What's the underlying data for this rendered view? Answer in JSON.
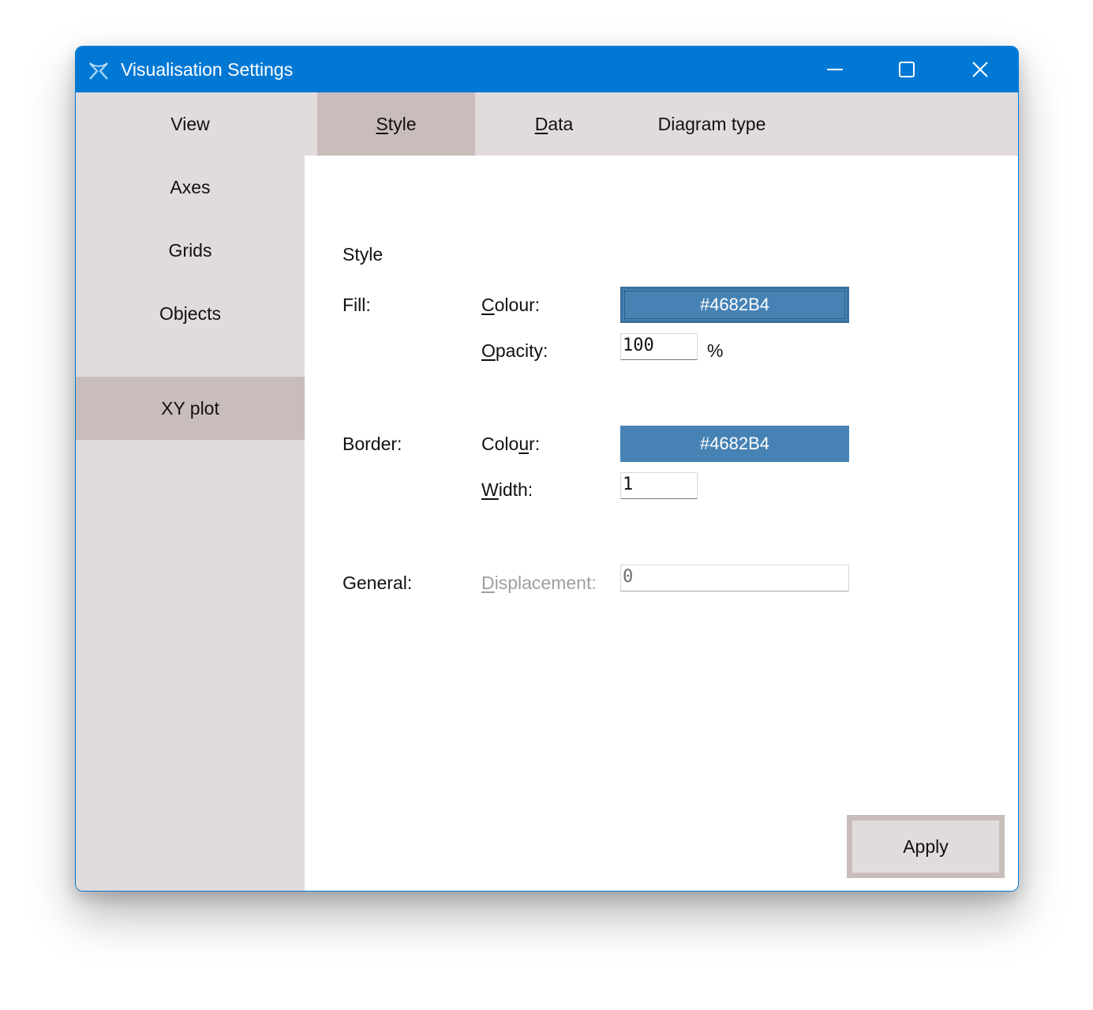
{
  "window": {
    "title": "Visualisation Settings",
    "accent_color": "#0078d4"
  },
  "title_buttons": {
    "minimize_icon": "minimize-icon",
    "maximize_icon": "maximize-icon",
    "close_icon": "close-icon"
  },
  "sidebar": {
    "items": [
      {
        "label": "View"
      },
      {
        "label": "Axes"
      },
      {
        "label": "Grids"
      },
      {
        "label": "Objects"
      },
      {
        "label": "XY plot",
        "active": true
      }
    ]
  },
  "tabs": [
    {
      "accel": "S",
      "rest": "tyle",
      "active": true
    },
    {
      "accel": "D",
      "rest": "ata"
    },
    {
      "pre": "Dia",
      "accel": "g",
      "rest": "ram type"
    }
  ],
  "style": {
    "section_title": "Style",
    "fill": {
      "label": "Fill:",
      "colour_label_accel": "C",
      "colour_label_rest": "olour:",
      "colour_value": "#4682B4",
      "opacity_label_accel": "O",
      "opacity_label_rest": "pacity:",
      "opacity_value": "100",
      "opacity_unit": "%"
    },
    "border": {
      "label": "Border:",
      "colour_label_pre": "Colo",
      "colour_label_accel": "u",
      "colour_label_rest": "r:",
      "colour_value": "#4682B4",
      "width_label_accel": "W",
      "width_label_rest": "idth:",
      "width_value": "1"
    },
    "general": {
      "label": "General:",
      "displacement_label_accel": "D",
      "displacement_label_rest": "isplacement:",
      "displacement_value": "0"
    }
  },
  "footer": {
    "apply_label": "Apply"
  },
  "colors": {
    "swatch": "#4682b4",
    "panel_bg": "#e1dcdb",
    "selected_bg": "#c9bdbc"
  }
}
